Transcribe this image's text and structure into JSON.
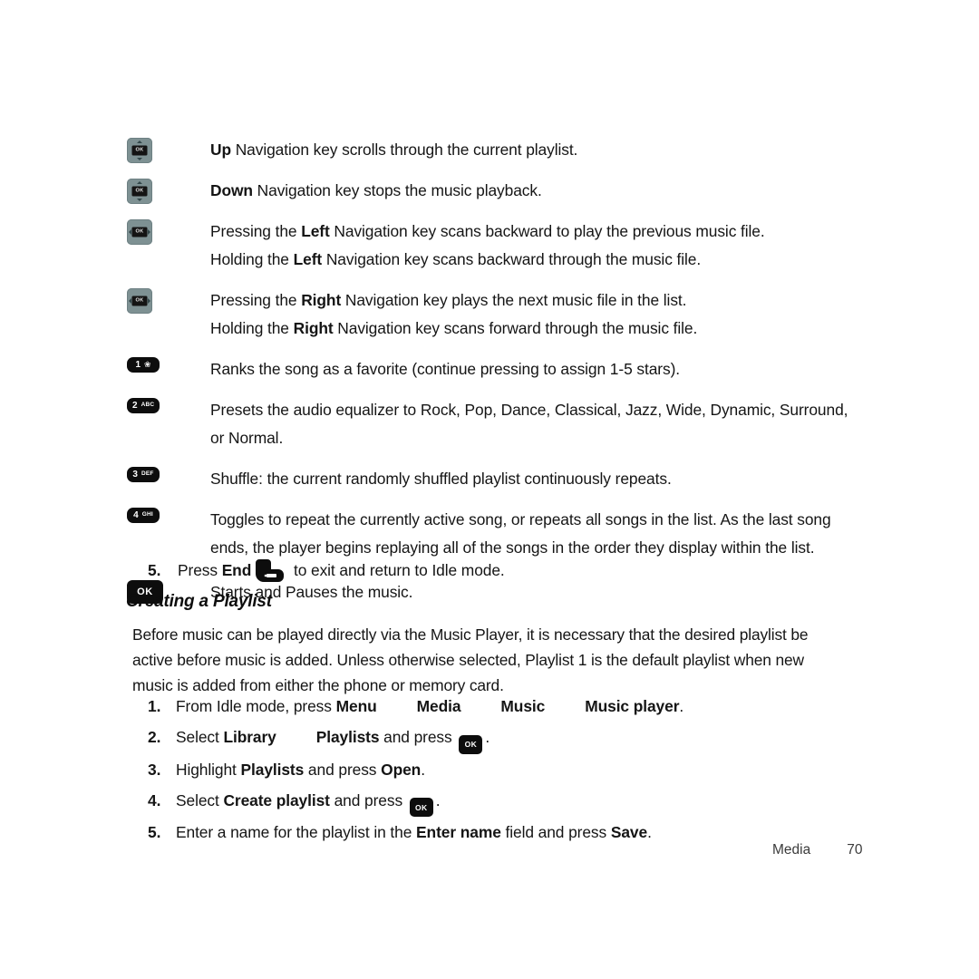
{
  "page": {
    "footer": {
      "section": "Media",
      "page_number": "70"
    }
  },
  "key_legend": [
    {
      "icon": "nav-key-up-icon",
      "icon_label": "OK",
      "direction": "up",
      "lines": [
        {
          "bold": "Up",
          "rest": " Navigation key scrolls through the current playlist."
        }
      ]
    },
    {
      "icon": "nav-key-down-icon",
      "icon_label": "OK",
      "direction": "down",
      "lines": [
        {
          "bold": "Down",
          "rest": " Navigation key stops the music playback."
        }
      ]
    },
    {
      "icon": "nav-key-left-icon",
      "icon_label": "OK",
      "direction": "left",
      "lines": [
        {
          "pre": "Pressing the ",
          "bold": "Left",
          "rest": " Navigation key scans backward to play the previous music file."
        },
        {
          "pre": "Holding the ",
          "bold": "Left",
          "rest": " Navigation key scans backward through the music file."
        }
      ]
    },
    {
      "icon": "nav-key-right-icon",
      "icon_label": "OK",
      "direction": "right",
      "lines": [
        {
          "pre": "Pressing the ",
          "bold": "Right",
          "rest": " Navigation key plays the next music file in the list."
        },
        {
          "pre": "Holding the ",
          "bold": "Right",
          "rest": " Navigation key scans forward through the music file."
        }
      ]
    },
    {
      "icon": "number-key-1-icon",
      "key_number": "1",
      "key_sub": "❀",
      "lines": [
        {
          "rest": "Ranks the song as a favorite (continue pressing to assign 1-5 stars)."
        }
      ]
    },
    {
      "icon": "number-key-2-icon",
      "key_number": "2",
      "key_sub": "ABC",
      "lines": [
        {
          "rest": "Presets the audio equalizer to Rock, Pop, Dance, Classical, Jazz, Wide, Dynamic, Surround, or Normal."
        }
      ]
    },
    {
      "icon": "number-key-3-icon",
      "key_number": "3",
      "key_sub": "DEF",
      "lines": [
        {
          "rest": "Shuffle: the current randomly shuffled playlist continuously repeats."
        }
      ]
    },
    {
      "icon": "number-key-4-icon",
      "key_number": "4",
      "key_sub": "GHI",
      "lines": [
        {
          "rest": "Toggles to repeat the currently active song, or repeats all songs in the list. As the last song ends, the player begins replaying all of the songs in the order they display within the list."
        }
      ]
    },
    {
      "icon": "ok-key-icon",
      "key_label": "OK",
      "lines": [
        {
          "rest": "Starts and Pauses the music."
        }
      ]
    }
  ],
  "step_exit": {
    "index": "5.",
    "pre": "Press ",
    "bold": "End",
    "icon": "end-call-key-icon",
    "rest": " to exit and return to Idle mode."
  },
  "section": {
    "heading": "Creating a Playlist",
    "intro": "Before music can be played directly via the Music Player, it is necessary that the desired playlist be active before music is added. Unless otherwise selected, Playlist 1 is the default playlist when new music is added from either the phone or memory card."
  },
  "playlist_steps": [
    {
      "index": "1.",
      "pre": "From Idle mode, press ",
      "menu_path": [
        "Menu",
        "Media",
        "Music",
        "Music player"
      ],
      "post": "."
    },
    {
      "index": "2.",
      "pre": "Select ",
      "bold_a": "Library",
      "bold_b": "Playlists",
      "mid": " and press ",
      "ok_label": "OK",
      "post": "."
    },
    {
      "index": "3.",
      "pre": "Highlight ",
      "bold_a": "Playlists",
      "mid": " and press ",
      "bold_b": "Open",
      "post": "."
    },
    {
      "index": "4.",
      "pre": "Select ",
      "bold_a": "Create playlist",
      "mid": " and press ",
      "ok_label": "OK",
      "post": "."
    },
    {
      "index": "5.",
      "pre": "Enter a name for the playlist in the ",
      "bold_a": "Enter name",
      "mid": " field and press ",
      "bold_b": "Save",
      "post": "."
    }
  ]
}
